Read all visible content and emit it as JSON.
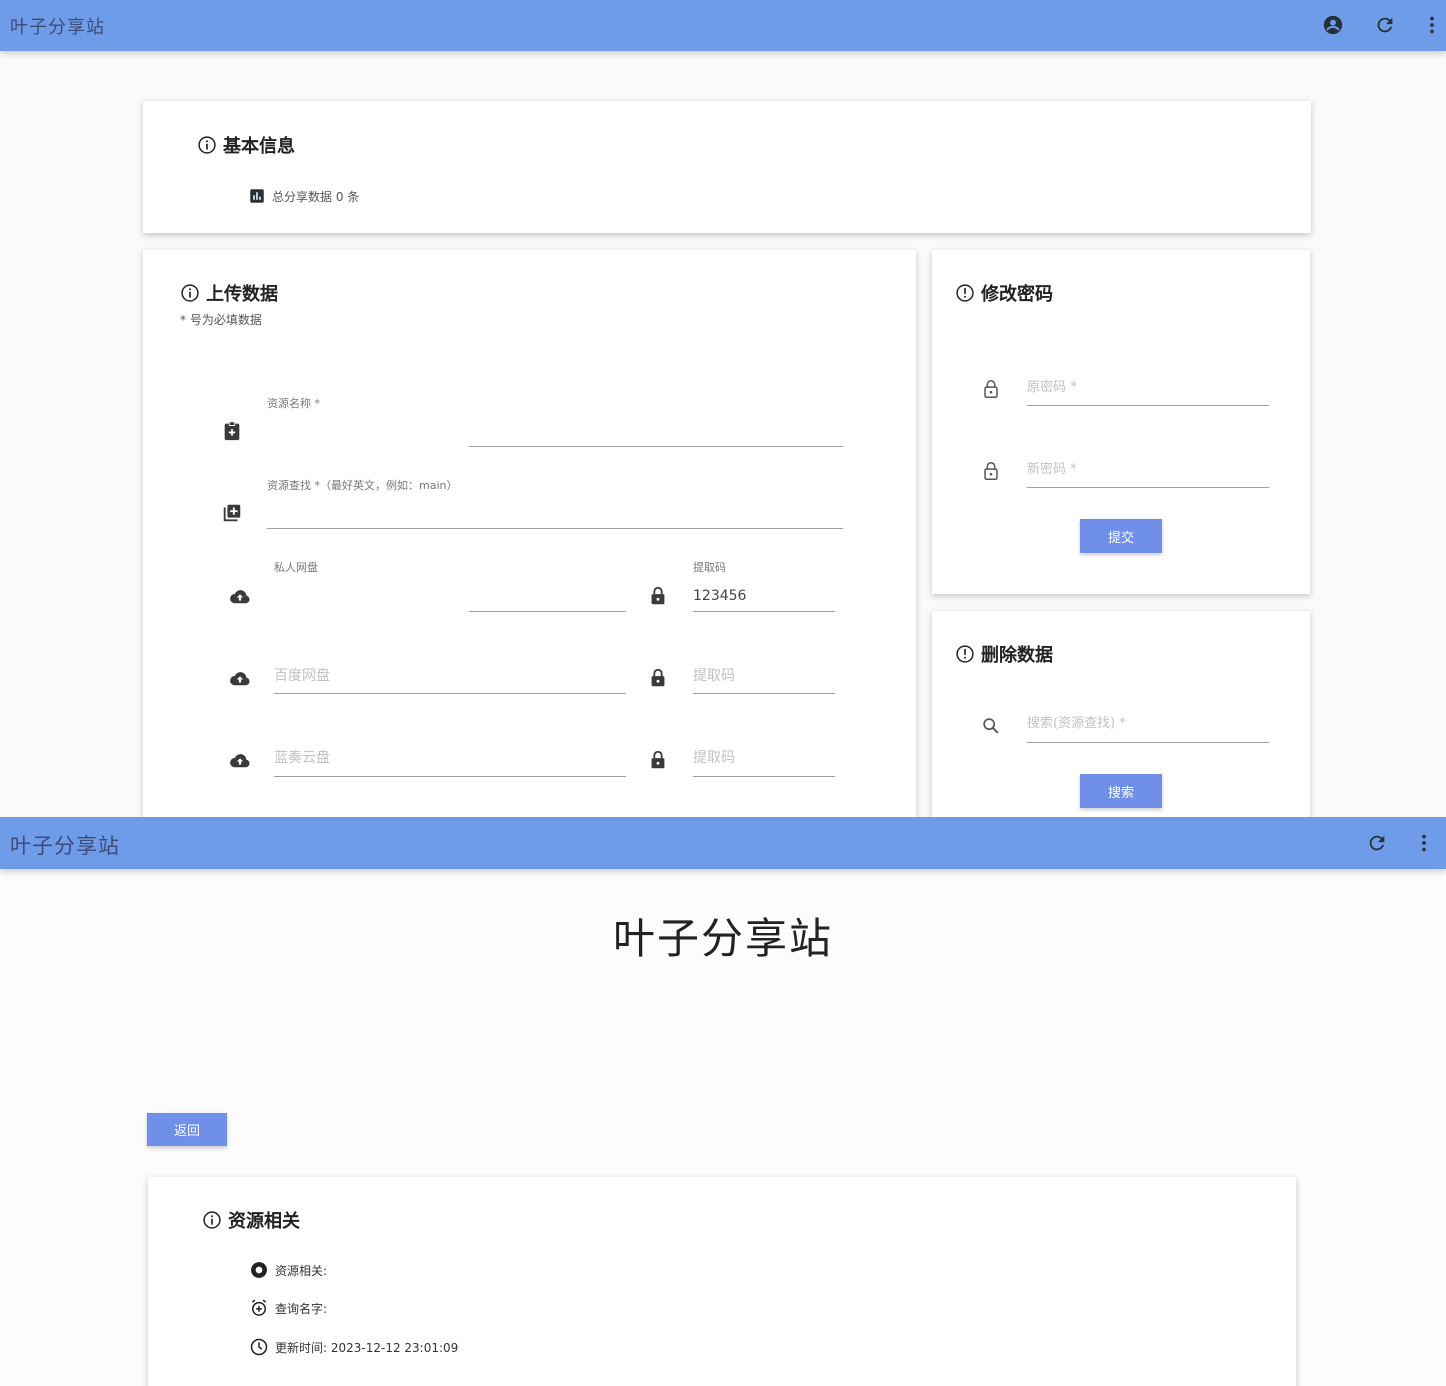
{
  "admin": {
    "app_title": "叶子分享站",
    "icons": [
      "account-circle-icon",
      "refresh-icon",
      "more-vert-icon"
    ],
    "basic_info": {
      "title": "基本信息",
      "total_label": "总分享数据 0 条"
    },
    "upload": {
      "title": "上传数据",
      "required_note": "* 号为必填数据",
      "resource_name_label": "资源名称 *",
      "resource_lookup_label": "资源查找 *（最好英文，例如：main）",
      "private_disk_label": "私人网盘",
      "code_label": "提取码",
      "code_value": "123456",
      "baidu_placeholder": "百度网盘",
      "code_placeholder_1": "提取码",
      "lanzou_placeholder": "蓝奏云盘",
      "code_placeholder_2": "提取码"
    },
    "change_password": {
      "title": "修改密码",
      "old_placeholder": "原密码 *",
      "new_placeholder": "新密码 *",
      "submit_label": "提交"
    },
    "delete_data": {
      "title": "删除数据",
      "search_placeholder": "搜索(资源查找) *",
      "search_label": "搜索"
    }
  },
  "detail": {
    "app_title": "叶子分享站",
    "icons": [
      "refresh-icon",
      "more-vert-icon"
    ],
    "page_heading": "叶子分享站",
    "back_label": "返回",
    "resource_card": {
      "title": "资源相关",
      "related_label": "资源相关:",
      "query_label": "查询名字:",
      "updated_label": "更新时间: 2023-12-12 23:01:09"
    }
  },
  "colors": {
    "appbar": "#6f9ce8",
    "button": "#6f8fe8",
    "card": "#ffffff",
    "background": "#fafafa"
  }
}
